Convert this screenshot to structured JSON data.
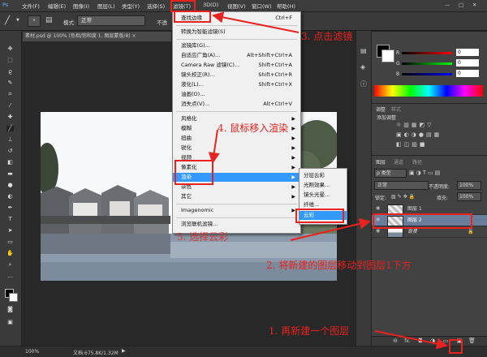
{
  "menubar": {
    "items": [
      "文件(F)",
      "编辑(E)",
      "图像(I)",
      "图层(L)",
      "类型(Y)",
      "选择(S)",
      "滤镜(T)",
      "3D(D)",
      "视图(V)",
      "窗口(W)",
      "帮助(H)"
    ]
  },
  "options": {
    "mode_label": "模式:",
    "mode_value": "正常",
    "opacity_label": "不透"
  },
  "document": {
    "tab_label": "素材.psd @ 100% (色相/饱和度 1, 图层蒙版/8) ×",
    "zoom": "100%",
    "doc_info": "文档:675.8K/1.32M"
  },
  "filter_menu": {
    "items": [
      {
        "label": "查找边缘",
        "shortcut": "Ctrl+F"
      },
      {
        "label": "转换为智能滤镜(S)",
        "shortcut": ""
      },
      {
        "label": "滤镜库(G)...",
        "shortcut": ""
      },
      {
        "label": "自适应广角(A)...",
        "shortcut": "Alt+Shift+Ctrl+A"
      },
      {
        "label": "Camera Raw 滤镜(C)...",
        "shortcut": "Shift+Ctrl+A"
      },
      {
        "label": "镜头校正(R)...",
        "shortcut": "Shift+Ctrl+R"
      },
      {
        "label": "液化(L)...",
        "shortcut": "Shift+Ctrl+X"
      },
      {
        "label": "油画(O)...",
        "shortcut": ""
      },
      {
        "label": "消失点(V)...",
        "shortcut": "Alt+Ctrl+V"
      },
      {
        "label": "风格化",
        "shortcut": ""
      },
      {
        "label": "模糊",
        "shortcut": ""
      },
      {
        "label": "扭曲",
        "shortcut": ""
      },
      {
        "label": "锐化",
        "shortcut": ""
      },
      {
        "label": "视频",
        "shortcut": ""
      },
      {
        "label": "像素化",
        "shortcut": ""
      },
      {
        "label": "渲染",
        "shortcut": ""
      },
      {
        "label": "杂色",
        "shortcut": ""
      },
      {
        "label": "其它",
        "shortcut": ""
      },
      {
        "label": "Imagenomic",
        "shortcut": ""
      },
      {
        "label": "浏览联机滤镜...",
        "shortcut": ""
      }
    ]
  },
  "render_submenu": {
    "items": [
      "分层云彩",
      "光照效果...",
      "镜头光晕...",
      "纤维...",
      "云彩"
    ]
  },
  "color_panel": {
    "r_label": "R",
    "r_value": "0",
    "g_label": "G",
    "g_value": "0",
    "b_label": "B",
    "b_value": "0"
  },
  "adjustments_panel": {
    "tabs": [
      "调整",
      "样式"
    ],
    "title": "添加调整"
  },
  "layers_panel": {
    "tabs": [
      "图层",
      "通道",
      "路径"
    ],
    "kind_label": "ρ 类型",
    "blend_mode": "正常",
    "opacity_label": "不透明度:",
    "opacity_value": "100%",
    "lock_label": "锁定:",
    "fill_label": "填充:",
    "fill_value": "100%",
    "layers": [
      {
        "name": "图层 1",
        "selected": false
      },
      {
        "name": "图层 2",
        "selected": true
      },
      {
        "name": "背景",
        "selected": false
      }
    ],
    "bottom_icons": [
      "link-icon",
      "fx-icon",
      "mask-icon",
      "adjustment-icon",
      "folder-icon",
      "new-layer-icon",
      "trash-icon"
    ],
    "bottom_labels": [
      "⊖",
      "fx.",
      "◘",
      "◑",
      "▭",
      "▣",
      "🗑"
    ]
  },
  "annotations": {
    "step1": "1. 再新建一个图层",
    "step2": "2. 将新建的图层移动到图层1下方",
    "step3": "3. 点击滤镜",
    "step4": "4. 鼠标移入渲染",
    "step5": "5. 选择云彩"
  },
  "colors": {
    "accent_red": "#e8221e",
    "highlight_blue": "#3399ff"
  }
}
